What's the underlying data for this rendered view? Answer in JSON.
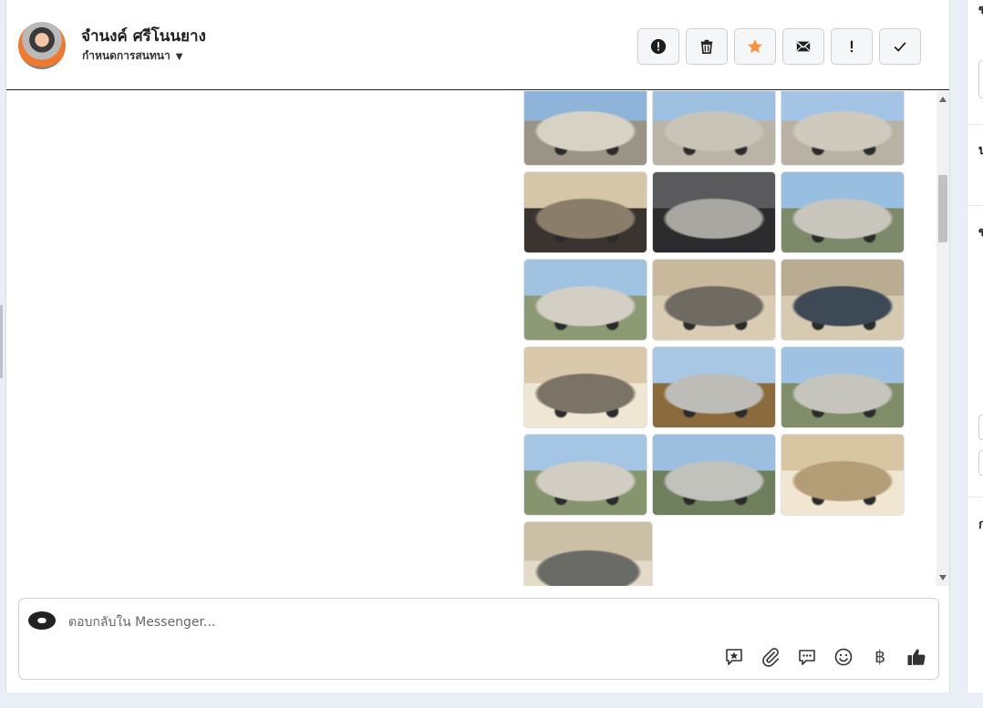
{
  "contact": {
    "name": "จำนงค์ ศรีโนนยาง",
    "assign_label": "กำหนดการสนทนา"
  },
  "header_actions": [
    {
      "name": "spam-button",
      "icon": "exclamation-circle-icon"
    },
    {
      "name": "delete-button",
      "icon": "trash-icon"
    },
    {
      "name": "star-button",
      "icon": "star-icon",
      "color": "#f7923a"
    },
    {
      "name": "mark-unread-button",
      "icon": "envelope-icon"
    },
    {
      "name": "follow-up-button",
      "icon": "exclamation-icon"
    },
    {
      "name": "mark-done-button",
      "icon": "check-icon"
    }
  ],
  "photos": [
    {
      "subject": "truck rear three-quarter",
      "colors": [
        "#8fb4d9",
        "#d8d2c4",
        "#9a9486"
      ]
    },
    {
      "subject": "truck side",
      "colors": [
        "#9ec1e2",
        "#c9c4b8",
        "#b9b4a6"
      ]
    },
    {
      "subject": "truck side",
      "colors": [
        "#a3c4e4",
        "#cfcabd",
        "#b7b2a4"
      ]
    },
    {
      "subject": "rear seat interior",
      "colors": [
        "#d6c6a8",
        "#8a7d6a",
        "#3a3430"
      ]
    },
    {
      "subject": "engine bay",
      "colors": [
        "#5a5a5c",
        "#a9a7a2",
        "#2c2c2e"
      ]
    },
    {
      "subject": "truck front",
      "colors": [
        "#98bfe0",
        "#c8c6bd",
        "#7d8a6a"
      ]
    },
    {
      "subject": "truck rear",
      "colors": [
        "#a0c3e2",
        "#d3cfc4",
        "#8c9a74"
      ]
    },
    {
      "subject": "dashboard",
      "colors": [
        "#c8b89c",
        "#6f6a62",
        "#d9ccb2"
      ]
    },
    {
      "subject": "gauge cluster",
      "colors": [
        "#b9ac93",
        "#3d4a56",
        "#d6cab1"
      ]
    },
    {
      "subject": "front seat interior",
      "colors": [
        "#d9c9aa",
        "#7c7367",
        "#efe6d4"
      ]
    },
    {
      "subject": "wheel close-up",
      "colors": [
        "#a8c7e4",
        "#bdbcb6",
        "#8b6a3b"
      ]
    },
    {
      "subject": "truck front three-quarter",
      "colors": [
        "#9fc2e3",
        "#c6c5bd",
        "#7f8d68"
      ]
    },
    {
      "subject": "truck rear three-quarter",
      "colors": [
        "#a4c5e4",
        "#d1cdc2",
        "#86956d"
      ]
    },
    {
      "subject": "truck front",
      "colors": [
        "#9dbfdf",
        "#c2c2bc",
        "#6f7f5c"
      ]
    },
    {
      "subject": "door panel",
      "colors": [
        "#d8c6a2",
        "#b39d76",
        "#f0e6d2"
      ]
    },
    {
      "subject": "center console",
      "colors": [
        "#cbbfa6",
        "#6a6a66",
        "#e3dac7"
      ]
    }
  ],
  "composer": {
    "placeholder": "ตอบกลับใน Messenger..."
  },
  "composer_tools": [
    {
      "name": "saved-reply-button",
      "icon": "star-bubble-icon"
    },
    {
      "name": "attach-button",
      "icon": "paperclip-icon"
    },
    {
      "name": "quick-reply-button",
      "icon": "chat-bubble-icon"
    },
    {
      "name": "emoji-button",
      "icon": "smile-icon"
    },
    {
      "name": "payment-button",
      "icon": "baht-icon",
      "glyph": "฿"
    },
    {
      "name": "like-button",
      "icon": "thumbs-up-icon"
    }
  ]
}
